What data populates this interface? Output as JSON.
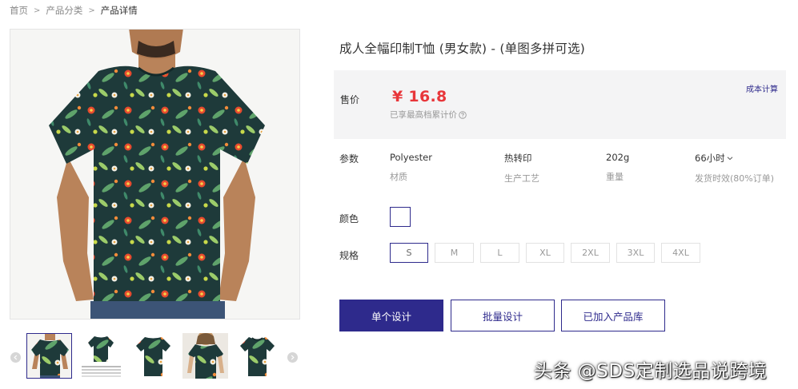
{
  "breadcrumb": {
    "home": "首页",
    "category": "产品分类",
    "current": "产品详情",
    "separator": ">"
  },
  "product": {
    "title": "成人全幅印制T恤 (男女款) - (单图多拼可选)",
    "price_label": "售价",
    "price": "¥ 16.8",
    "price_note": "已享最高档累计价",
    "cost_link": "成本计算"
  },
  "params": {
    "label": "参数",
    "items": [
      {
        "value": "Polyester",
        "label": "材质"
      },
      {
        "value": "热转印",
        "label": "生产工艺"
      },
      {
        "value": "202g",
        "label": "重量"
      },
      {
        "value": "66小时",
        "label": "发货时效(80%订单)"
      }
    ]
  },
  "color": {
    "label": "颜色",
    "selected_swatch": "#ffffff"
  },
  "sizes": {
    "label": "规格",
    "options": [
      "S",
      "M",
      "L",
      "XL",
      "2XL",
      "3XL",
      "4XL"
    ],
    "selected": "S"
  },
  "actions": {
    "single_design": "单个设计",
    "batch_design": "批量设计",
    "added_to_library": "已加入产品库"
  },
  "gallery": {
    "icons": {
      "prev": "chevron-left-icon",
      "next": "chevron-right-icon",
      "help": "question-circle-icon",
      "dropdown": "chevron-down-icon"
    },
    "thumbnails": [
      "front-model",
      "front-flat-with-size-chart",
      "back-flat",
      "female-model",
      "front-flat"
    ],
    "active_index": 0
  },
  "watermark": "头条 @SDS定制选品说跨境",
  "colors": {
    "accent": "#2e2a8c",
    "price": "#e8363a",
    "price_bg": "#f4f4f5",
    "shirt_base": "#1e3a3a"
  }
}
